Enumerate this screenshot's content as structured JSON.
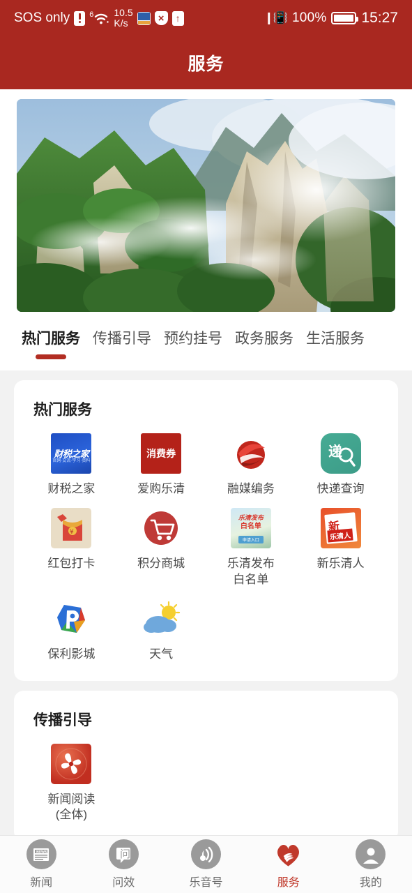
{
  "status_bar": {
    "carrier": "SOS only",
    "warning_icon": "warning-icon",
    "network_gen": "6",
    "wifi_icon": "wifi-icon",
    "speed": "10.5",
    "speed_unit": "K/s",
    "app_icon": "app-notification-icon",
    "shield_icon": "shield-blocked-icon",
    "upload_icon": "upload-arrow-icon",
    "vibrate_icon": "vibrate-icon",
    "battery_percent": "100%",
    "battery_icon": "battery-full-icon",
    "time": "15:27"
  },
  "header": {
    "title": "服务"
  },
  "banner": {
    "name": "hero-banner-image",
    "alt": "雁荡山风景",
    "colors": {
      "sky": "#a8c6e0",
      "cloud": "#eef3f7",
      "foliage": "#3f7a32",
      "rock": "#cbbfa0"
    }
  },
  "tabs": {
    "active_index": 0,
    "items": [
      {
        "label": "热门服务"
      },
      {
        "label": "传播引导"
      },
      {
        "label": "预约挂号"
      },
      {
        "label": "政务服务"
      },
      {
        "label": "生活服务"
      }
    ]
  },
  "sections": [
    {
      "title": "热门服务",
      "items": [
        {
          "label": "财税之家",
          "icon": "caishuizhijia-app-icon",
          "art": "caishui",
          "t1": "财税之家",
          "t2": "官网·交流·学习·资料"
        },
        {
          "label": "爱购乐清",
          "icon": "aigouleqing-app-icon",
          "art": "xiaofei",
          "t1": "消费券"
        },
        {
          "label": "融媒编务",
          "icon": "rongmeibianwu-app-icon",
          "art": "rongmei"
        },
        {
          "label": "快递查询",
          "icon": "kuaidichaxun-app-icon",
          "art": "kuaidi"
        },
        {
          "label": "红包打卡",
          "icon": "hongbaodaka-app-icon",
          "art": "hongbao"
        },
        {
          "label": "积分商城",
          "icon": "jifenshangcheng-app-icon",
          "art": "jifen"
        },
        {
          "label": "乐清发布\n白名单",
          "icon": "leqingfabu-baimingdan-app-icon",
          "art": "baimingdan",
          "l1": "乐清发布",
          "l2": "白名单",
          "badge": "申请入口"
        },
        {
          "label": "新乐清人",
          "icon": "xinleqingren-app-icon",
          "art": "xinleqing",
          "t1": "新",
          "t2": "乐清人"
        },
        {
          "label": "保利影城",
          "icon": "baoliyingcheng-app-icon",
          "art": "baoli"
        },
        {
          "label": "天气",
          "icon": "tianqi-app-icon",
          "art": "tianqi"
        }
      ]
    },
    {
      "title": "传播引导",
      "items": [
        {
          "label": "新闻阅读\n(全体)",
          "icon": "xinwenyuedu-app-icon",
          "art": "xinwen"
        }
      ]
    }
  ],
  "bottom_nav": {
    "active_index": 3,
    "items": [
      {
        "label": "新闻",
        "icon": "news-icon"
      },
      {
        "label": "问效",
        "icon": "feedback-bubble-icon"
      },
      {
        "label": "乐音号",
        "icon": "audio-wave-icon"
      },
      {
        "label": "服务",
        "icon": "heart-hand-service-icon"
      },
      {
        "label": "我的",
        "icon": "user-profile-icon"
      }
    ]
  },
  "theme": {
    "brand_red": "#a92820",
    "accent_red": "#b22d22",
    "nav_active": "#c0392b",
    "page_bg": "#f2f2f2",
    "card_bg": "#ffffff"
  }
}
